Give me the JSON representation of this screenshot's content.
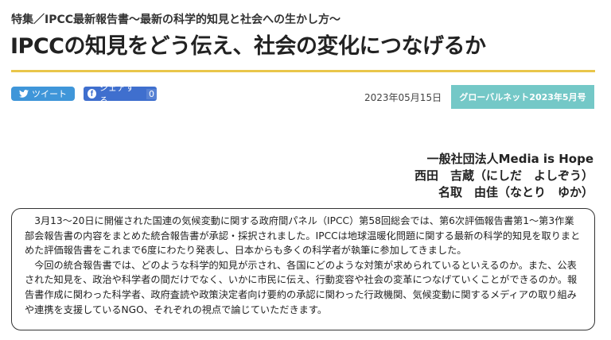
{
  "header": {
    "kicker": "特集／IPCC最新報告書〜最新の科学的知見と社会への生かし方〜",
    "title": "IPCCの知見をどう伝え、社会の変化につなげるか"
  },
  "share": {
    "tweet_label": "ツイート",
    "facebook_label": "シェアする",
    "facebook_count": "0"
  },
  "meta": {
    "date": "2023年05月15日",
    "issue_badge": "グローバルネット2023年5月号"
  },
  "author": {
    "organization": "一般社団法人Media is Hope",
    "person1": "西田　吉蔵（にしだ　よしぞう）",
    "person2": "名取　由佳（なとり　ゆか）"
  },
  "summary": {
    "paragraph1": "3月13〜20日に開催された国連の気候変動に関する政府間パネル（IPCC）第58回総会では、第6次評価報告書第1〜第3作業部会報告書の内容をまとめた統合報告書が承認・採択されました。IPCCは地球温暖化問題に関する最新の科学的知見を取りまとめた評価報告書をこれまで6度にわたり発表し、日本からも多くの科学者が執筆に参加してきました。",
    "paragraph2": "今回の統合報告書では、どのような科学的知見が示され、各国にどのような対策が求められているといえるのか。また、公表された知見を、政治や科学者の間だけでなく、いかに市民に伝え、行動変容や社会の変革につなげていくことができるのか。報告書作成に関わった科学者、政府査読や政策決定者向け要約の承認に関わった行政機関、気候変動に関するメディアの取り組みや連携を支援しているNGO、それぞれの視点で論じていただきます。"
  },
  "colors": {
    "rule": "#e9c64a",
    "tweet": "#3f96d9",
    "facebook": "#3f6fce",
    "badge": "#74c8c7"
  },
  "icons": [
    "twitter-bird-icon",
    "facebook-icon"
  ]
}
